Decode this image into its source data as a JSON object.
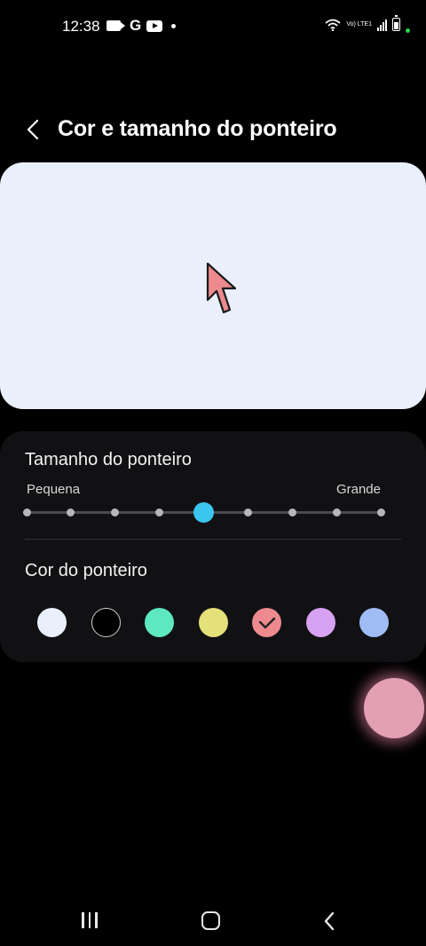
{
  "status_bar": {
    "time": "12:38",
    "network_label": "Vo) LTE1"
  },
  "header": {
    "title": "Cor e tamanho do ponteiro"
  },
  "preview": {
    "pointer_color": "#ec8a8e"
  },
  "pointer_size": {
    "title": "Tamanho do ponteiro",
    "min_label": "Pequena",
    "max_label": "Grande",
    "steps": 9,
    "selected_step": 4
  },
  "pointer_color": {
    "title": "Cor do ponteiro",
    "options": [
      {
        "name": "white",
        "color": "#e9f0fb",
        "selected": false
      },
      {
        "name": "black",
        "color": "#000000",
        "selected": false
      },
      {
        "name": "green",
        "color": "#5ee8c0",
        "selected": false
      },
      {
        "name": "yellow",
        "color": "#e4e07a",
        "selected": false
      },
      {
        "name": "pink",
        "color": "#ec8a8e",
        "selected": true
      },
      {
        "name": "purple",
        "color": "#d8a2f2",
        "selected": false
      },
      {
        "name": "blue",
        "color": "#9fbcf4",
        "selected": false
      }
    ]
  },
  "colors": {
    "accent": "#3bc6ee",
    "background": "#000000",
    "card": "#111114",
    "preview_bg": "#e9f0fb"
  }
}
